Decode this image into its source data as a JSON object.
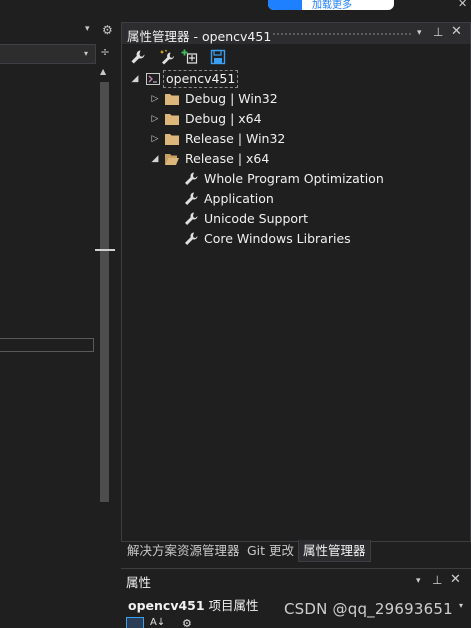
{
  "overlay": {
    "badge_text": "加载更多",
    "close_glyph": "✕",
    "watermark": "CSDN @qq_29693651"
  },
  "left_pane": {
    "dropdown_glyph": "▾",
    "settings_glyph": "⚙",
    "combobox_arrow_glyph": "▾",
    "split_glyph": "÷",
    "scroll_up_glyph": "▲"
  },
  "property_manager": {
    "title": "属性管理器 - opencv451",
    "dropdown_glyph": "▾",
    "pin_glyph": "⊥",
    "close_glyph": "✕",
    "toolbar": [
      "wrench-icon",
      "magic-wand-icon",
      "add-property-sheet-icon",
      "save-icon"
    ],
    "tree": {
      "root": {
        "label": "opencv451",
        "expanded": true,
        "icon": "project-icon"
      },
      "configs": [
        {
          "label": "Debug | Win32",
          "expanded": false,
          "icon": "folder-icon"
        },
        {
          "label": "Debug | x64",
          "expanded": false,
          "icon": "folder-icon"
        },
        {
          "label": "Release | Win32",
          "expanded": false,
          "icon": "folder-icon"
        },
        {
          "label": "Release | x64",
          "expanded": true,
          "icon": "open-folder-icon",
          "sheets": [
            {
              "label": "Whole Program Optimization",
              "icon": "wrench-icon"
            },
            {
              "label": "Application",
              "icon": "wrench-icon"
            },
            {
              "label": "Unicode Support",
              "icon": "wrench-icon"
            },
            {
              "label": "Core Windows Libraries",
              "icon": "wrench-icon"
            }
          ]
        }
      ]
    }
  },
  "tabs": [
    {
      "label": "解决方案资源管理器",
      "active": false
    },
    {
      "label": "Git 更改",
      "active": false
    },
    {
      "label": "属性管理器",
      "active": true
    }
  ],
  "properties": {
    "title": "属性",
    "dropdown_glyph": "▾",
    "pin_glyph": "⊥",
    "close_glyph": "✕",
    "object_name": "opencv451",
    "object_suffix": " 项目属性",
    "object_arrow_glyph": "▾"
  },
  "colors": {
    "background": "#1f1f1f",
    "title_bar": "#2d2d30",
    "accent_blue": "#1e80ff",
    "folder": "#dcb67a",
    "save_icon": "#3aa0f3"
  }
}
